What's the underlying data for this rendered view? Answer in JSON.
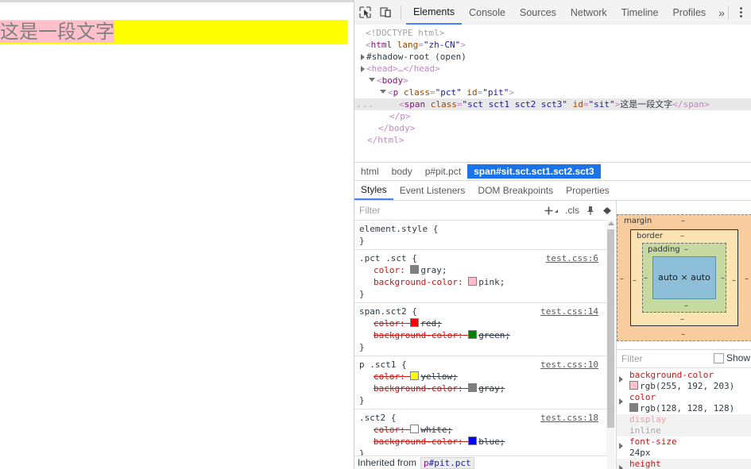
{
  "viewport": {
    "paragraph_text": "这是一段文字",
    "span_bg": "#ffc0cb",
    "span_color": "#808080",
    "para_bg": "#ffff00"
  },
  "devtools": {
    "toolbar": {
      "inspect_icon": "inspect-element-icon",
      "device_icon": "device-toolbar-icon",
      "more_tabs_label": "»",
      "menu_icon": "kebab-menu-icon",
      "tabs": [
        {
          "label": "Elements",
          "active": true
        },
        {
          "label": "Console",
          "active": false
        },
        {
          "label": "Sources",
          "active": false
        },
        {
          "label": "Network",
          "active": false
        },
        {
          "label": "Timeline",
          "active": false
        },
        {
          "label": "Profiles",
          "active": false
        }
      ]
    },
    "dom_tree": {
      "doctype": "<!DOCTYPE html>",
      "html_open": "<html lang=\"zh-CN\">",
      "html_tag": "html",
      "html_attr_name": "lang",
      "html_attr_value": "\"zh-CN\"",
      "shadow_root": "#shadow-root (open)",
      "head_collapsed": "<head>…</head>",
      "body_open": "<body>",
      "p_tag": "p",
      "p_attr1_name": "class",
      "p_attr1_value": "\"pct\"",
      "p_attr2_name": "id",
      "p_attr2_value": "\"pit\"",
      "span_tag": "span",
      "span_attr1_name": "class",
      "span_attr1_value": "\"sct sct1 sct2 sct3\"",
      "span_attr2_name": "id",
      "span_attr2_value": "\"sit\"",
      "span_text": "这是一段文字",
      "span_close": "</span>",
      "p_close": "</p>",
      "body_close": "</body>",
      "html_close": "</html>",
      "selected_marker": "…"
    },
    "breadcrumb": [
      {
        "label": "html",
        "active": false
      },
      {
        "label": "body",
        "active": false
      },
      {
        "label": "p#pit.pct",
        "active": false
      },
      {
        "label": "span#sit.sct.sct1.sct2.sct3",
        "active": true
      }
    ],
    "sidebar_tabs": [
      {
        "label": "Styles",
        "active": true
      },
      {
        "label": "Event Listeners",
        "active": false
      },
      {
        "label": "DOM Breakpoints",
        "active": false
      },
      {
        "label": "Properties",
        "active": false
      }
    ],
    "styles": {
      "filter_placeholder": "Filter",
      "new_rule_icon": "plus-icon",
      "cls_label": ".cls",
      "pin_icon": "pin-icon",
      "layers_icon": "layers-icon",
      "rules": [
        {
          "selector": "element.style {",
          "close": "}",
          "source": "",
          "declarations": []
        },
        {
          "selector": ".pct .sct {",
          "close": "}",
          "source": "test.css:6",
          "declarations": [
            {
              "name": "color:",
              "value": "gray;",
              "swatch": "#808080",
              "overridden": false
            },
            {
              "name": "background-color:",
              "value": "pink;",
              "swatch": "#ffc0cb",
              "overridden": false
            }
          ]
        },
        {
          "selector": "span.sct2 {",
          "close": "}",
          "source": "test.css:14",
          "declarations": [
            {
              "name": "color:",
              "value": "red;",
              "swatch": "#ff0000",
              "overridden": true
            },
            {
              "name": "background-color:",
              "value": "green;",
              "swatch": "#008000",
              "overridden": true
            }
          ]
        },
        {
          "selector": "p .sct1 {",
          "close": "}",
          "source": "test.css:10",
          "declarations": [
            {
              "name": "color:",
              "value": "yellow;",
              "swatch": "#ffff00",
              "overridden": true
            },
            {
              "name": "background-color:",
              "value": "gray;",
              "swatch": "#808080",
              "overridden": true
            }
          ]
        },
        {
          "selector": ".sct2 {",
          "close": "}",
          "source": "test.css:18",
          "declarations": [
            {
              "name": "color:",
              "value": "white;",
              "swatch": "#ffffff",
              "overridden": true
            },
            {
              "name": "background-color:",
              "value": "blue;",
              "swatch": "#0000ff",
              "overridden": true
            }
          ]
        }
      ],
      "inherited_label": "Inherited from",
      "inherited_tag": "p",
      "inherited_id": "#pit.pct"
    },
    "computed": {
      "box_model": {
        "margin_label": "margin",
        "margin_value": "–",
        "border_label": "border",
        "border_value": "–",
        "padding_label": "padding",
        "padding_value": "–",
        "content_value": "auto × auto"
      },
      "filter_placeholder": "Filter",
      "show_all_label": "Show",
      "properties": [
        {
          "name": "background-color",
          "value": "rgb(255, 192, 203)",
          "swatch": "#ffc0cb",
          "expandable": true,
          "dim": false
        },
        {
          "name": "color",
          "value": "rgb(128, 128, 128)",
          "swatch": "#808080",
          "expandable": true,
          "dim": false
        },
        {
          "name": "display",
          "value": "inline",
          "swatch": "",
          "expandable": false,
          "dim": true
        },
        {
          "name": "font-size",
          "value": "24px",
          "swatch": "",
          "expandable": true,
          "dim": false
        },
        {
          "name": "height",
          "value": "",
          "swatch": "",
          "expandable": true,
          "dim": false
        }
      ]
    }
  }
}
